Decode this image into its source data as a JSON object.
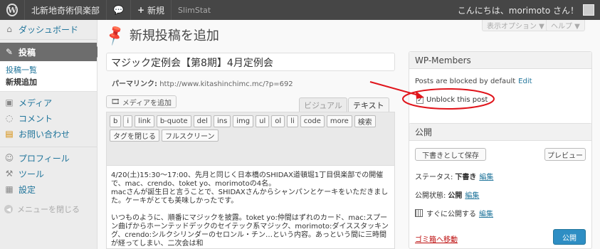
{
  "adminbar": {
    "wp_logo": "W",
    "site_name": "北新地奇術倶楽部",
    "new_label": "新規",
    "slimstat": "SlimStat",
    "greeting": "こんにちは、morimoto さん！"
  },
  "sidebar": {
    "dashboard": "ダッシュボード",
    "posts": "投稿",
    "posts_list": "投稿一覧",
    "posts_new": "新規追加",
    "media": "メディア",
    "comments": "コメント",
    "contact": "お問い合わせ",
    "profile": "プロフィール",
    "tools": "ツール",
    "settings": "設定",
    "collapse": "メニューを閉じる"
  },
  "main": {
    "screen_options": "表示オプション ▼",
    "help": "ヘルプ ▼",
    "page_title": "新規投稿を追加",
    "post_title": "マジック定例会【第8期】4月定例会",
    "permalink_label": "パーマリンク:",
    "permalink_url": "http://www.kitashinchimc.mc/?p=692",
    "add_media": "メディアを追加",
    "tab_visual": "ビジュアル",
    "tab_text": "テキスト",
    "quicktags_row1": [
      "b",
      "i",
      "link",
      "b-quote",
      "del",
      "ins",
      "img",
      "ul",
      "ol",
      "li",
      "code",
      "more",
      "検索"
    ],
    "quicktags_row2": [
      "タグを閉じる",
      "フルスクリーン"
    ],
    "content_p1": "4/20(土)15:30～17:00、先月と同じく日本橋のSHIDAX道頓堀1丁目倶楽部での開催で、mac、crendo、toket yo、morimotoの4名。\nmacさんが誕生日と言うことで、SHIDAXさんからシャンパンとケーキをいただきました。ケーキがとても美味しかったです。",
    "content_p2": "いつものように、順番にマジックを披露。toket yo:仲間はずれのカード、mac:スプーン曲げからホーンテッドデックのセイテック系マジック、morimoto:ダイススタッキング、crendo:シルクシリンダーのセロンル・チン…という内容。あっという間に三時間が経ってしまい、二次会は和"
  },
  "wpmembers": {
    "title": "WP-Members",
    "blocked_text": "Posts are blocked by default",
    "edit": "Edit",
    "unblock": "Unblock this post",
    "unblock_checked": "✓"
  },
  "publish": {
    "title": "公開",
    "save_draft": "下書きとして保存",
    "preview": "プレビュー",
    "status_label": "ステータス:",
    "status_value": "下書き",
    "status_edit": "編集",
    "visibility_label": "公開状態:",
    "visibility_value": "公開",
    "visibility_edit": "編集",
    "schedule_label": "すぐに公開する",
    "schedule_edit": "編集",
    "trash": "ゴミ箱へ移動",
    "publish_btn": "公開"
  },
  "colors": {
    "admin_bar": "#464646",
    "link": "#21759b",
    "publish_button": "#2e8ec4",
    "annotation": "#e0141b"
  }
}
